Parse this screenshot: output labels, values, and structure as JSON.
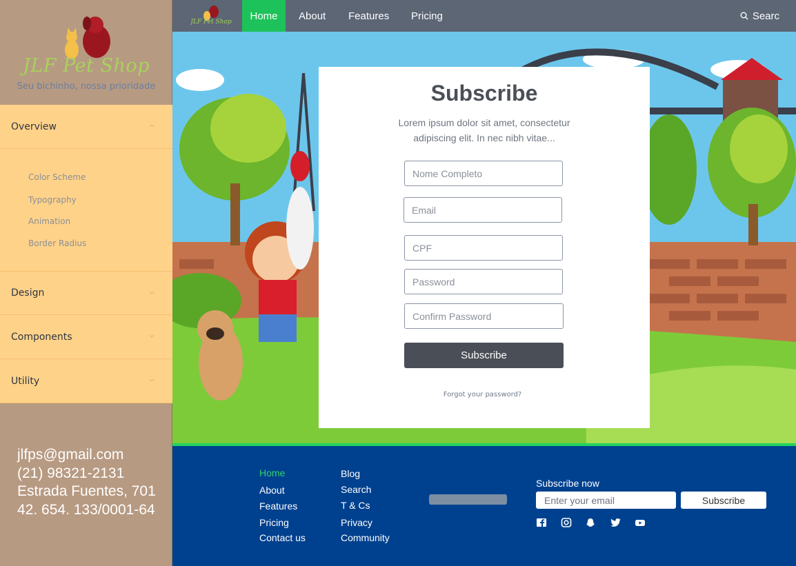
{
  "brand": {
    "name": "JLF Pet Shop",
    "tagline": "Seu bichinho, nossa prioridade"
  },
  "sidebar": {
    "sections": [
      {
        "label": "Overview",
        "expanded": true
      },
      {
        "label": "Design",
        "expanded": false
      },
      {
        "label": "Components",
        "expanded": false
      },
      {
        "label": "Utility",
        "expanded": false
      }
    ],
    "overview_items": [
      "Color Scheme",
      "Typography",
      "Animation",
      "Border Radius"
    ]
  },
  "contact": {
    "email": "jlfps@gmail.com",
    "phone": "(21) 98321-2131",
    "address": "Estrada Fuentes, 701",
    "cnpj": "42. 654. 133/0001-64"
  },
  "navbar": {
    "links": [
      "Home",
      "About",
      "Features",
      "Pricing"
    ],
    "active": "Home",
    "search_label": "Searc"
  },
  "form": {
    "title": "Subscribe",
    "subtitle": "Lorem ipsum dolor sit amet, consectetur adipiscing elit. In nec nibh vitae...",
    "fields": {
      "name": "Nome Completo",
      "email": "Email",
      "cpf": "CPF",
      "password": "Password",
      "confirm": "Confirm Password"
    },
    "submit_label": "Subscribe",
    "forgot_label": "Forgot your password?"
  },
  "footer": {
    "col1": [
      "Home",
      "About",
      "Features",
      "Pricing",
      "Contact us"
    ],
    "col2": [
      "Blog",
      "Search",
      "T & Cs",
      "Privacy",
      "Community"
    ],
    "subscribe_label": "Subscribe now",
    "email_placeholder": "Enter your email",
    "subscribe_button": "Subscribe",
    "social_icons": [
      "facebook-icon",
      "instagram-icon",
      "snapchat-icon",
      "twitter-icon",
      "youtube-icon"
    ]
  },
  "colors": {
    "sidebar_bg": "#b79a82",
    "menu_bg": "#ffd28a",
    "navbar_bg": "#5c6675",
    "active_green": "#1ec25a",
    "footer_bg": "#00418f",
    "button_dark": "#4a4f57"
  }
}
